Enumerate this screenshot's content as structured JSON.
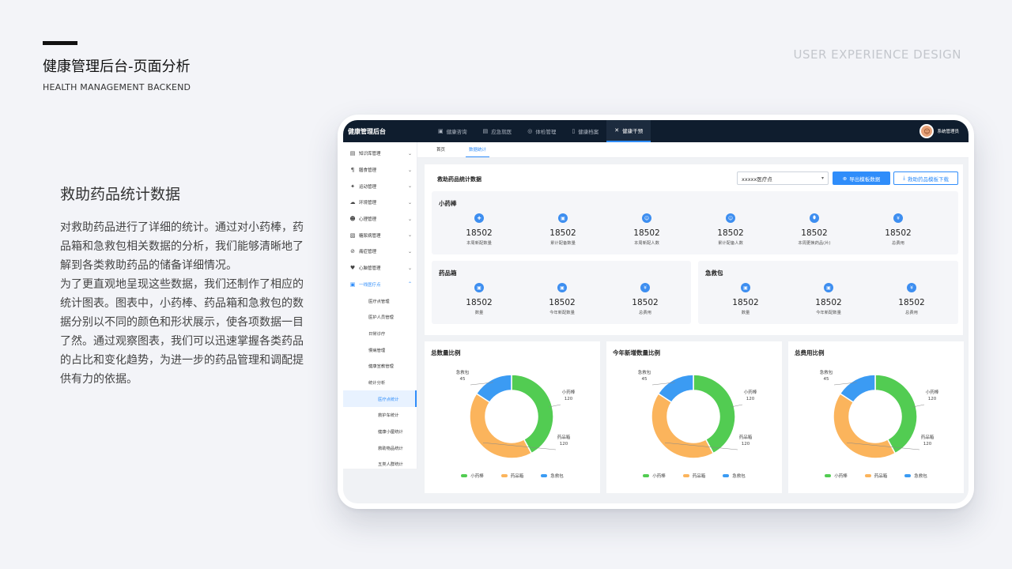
{
  "slide": {
    "title": "健康管理后台-页面分析",
    "subtitle": "HEALTH MANAGEMENT BACKEND",
    "tag": "USER EXPERIENCE DESIGN",
    "section_title": "救助药品统计数据",
    "paragraphs": [
      "对救助药品进行了详细的统计。通过对小药棒，药品箱和急救包相关数据的分析，我们能够清晰地了解到各类救助药品的储备详细情况。",
      "为了更直观地呈现这些数据，我们还制作了相应的统计图表。图表中，小药棒、药品箱和急救包的数据分别以不同的颜色和形状展示，使各项数据一目了然。通过观察图表，我们可以迅速掌握各类药品的占比和变化趋势，为进一步的药品管理和调配提供有力的依据。"
    ]
  },
  "app": {
    "logo": "健康管理后台",
    "nav": [
      {
        "label": "健康咨询",
        "icon": "chat-icon",
        "glyph": "▣"
      },
      {
        "label": "应急就医",
        "icon": "emergency-icon",
        "glyph": "▤"
      },
      {
        "label": "体检管理",
        "icon": "checkup-icon",
        "glyph": "◎"
      },
      {
        "label": "健康档案",
        "icon": "file-icon",
        "glyph": "▯"
      },
      {
        "label": "健康干预",
        "icon": "intervention-icon",
        "glyph": "✕",
        "active": true
      }
    ],
    "user": "系统管理员",
    "sidebar": [
      {
        "label": "知识库管理",
        "glyph": "▤"
      },
      {
        "label": "膳食管理",
        "glyph": "¶"
      },
      {
        "label": "运动管理",
        "glyph": "✦"
      },
      {
        "label": "环境管理",
        "glyph": "☁"
      },
      {
        "label": "心理管理",
        "glyph": "☻"
      },
      {
        "label": "糖尿病管理",
        "glyph": "▧"
      },
      {
        "label": "痛症管理",
        "glyph": "⊘"
      },
      {
        "label": "心脑管管理",
        "glyph": "♥"
      },
      {
        "label": "一线医疗点",
        "glyph": "▣",
        "open": true
      }
    ],
    "sidebar_sub": [
      "医疗点管理",
      "医护人员管理",
      "日常诊疗",
      "慢病管理",
      "健康宣教管理",
      "统计分析"
    ],
    "sidebar_sub2": [
      {
        "label": "医疗点统计",
        "active": true
      },
      {
        "label": "救护车统计"
      },
      {
        "label": "健康小屋统计"
      },
      {
        "label": "救助物品统计"
      },
      {
        "label": "五类人群统计"
      }
    ],
    "tabs": [
      {
        "label": "首页"
      },
      {
        "label": "数据统计",
        "active": true
      }
    ],
    "panel_title": "救助药品统计数据",
    "select_value": "xxxxx医疗点",
    "export_button": "导出模板数据",
    "download_button": "救助药品模板下载",
    "cards": {
      "stick": {
        "title": "小药棒",
        "stats": [
          {
            "value": "18502",
            "label": "本周新配数量"
          },
          {
            "value": "18502",
            "label": "累计配备数量"
          },
          {
            "value": "18502",
            "label": "本周新配人数"
          },
          {
            "value": "18502",
            "label": "累计配备人数"
          },
          {
            "value": "18502",
            "label": "本周更换药品(片)"
          },
          {
            "value": "18502",
            "label": "总费用"
          }
        ]
      },
      "box": {
        "title": "药品箱",
        "stats": [
          {
            "value": "18502",
            "label": "数量"
          },
          {
            "value": "18502",
            "label": "今年新配数量"
          },
          {
            "value": "18502",
            "label": "总费用"
          }
        ]
      },
      "kit": {
        "title": "急救包",
        "stats": [
          {
            "value": "18502",
            "label": "数量"
          },
          {
            "value": "18502",
            "label": "今年新配数量"
          },
          {
            "value": "18502",
            "label": "总费用"
          }
        ]
      }
    }
  },
  "colors": {
    "stick": "#52cc52",
    "box": "#fbb45c",
    "kit": "#3b9bf3",
    "accent": "#2f8dfa"
  },
  "chart_data": [
    {
      "type": "pie",
      "title": "总数量比例",
      "categories": [
        "小药棒",
        "药品箱",
        "急救包"
      ],
      "values": [
        120,
        120,
        45
      ],
      "slice_labels": [
        "小药棒\n120",
        "药品箱\n120",
        "急救包\n45"
      ]
    },
    {
      "type": "pie",
      "title": "今年新增数量比例",
      "categories": [
        "小药棒",
        "药品箱",
        "急救包"
      ],
      "values": [
        120,
        120,
        45
      ],
      "slice_labels": [
        "小药棒\n120",
        "药品箱\n120",
        "急救包\n45"
      ]
    },
    {
      "type": "pie",
      "title": "总费用比例",
      "categories": [
        "小药棒",
        "药品箱",
        "急救包"
      ],
      "values": [
        120,
        120,
        45
      ],
      "slice_labels": [
        "小药棒\n120",
        "药品箱\n120",
        "急救包\n45"
      ]
    }
  ]
}
